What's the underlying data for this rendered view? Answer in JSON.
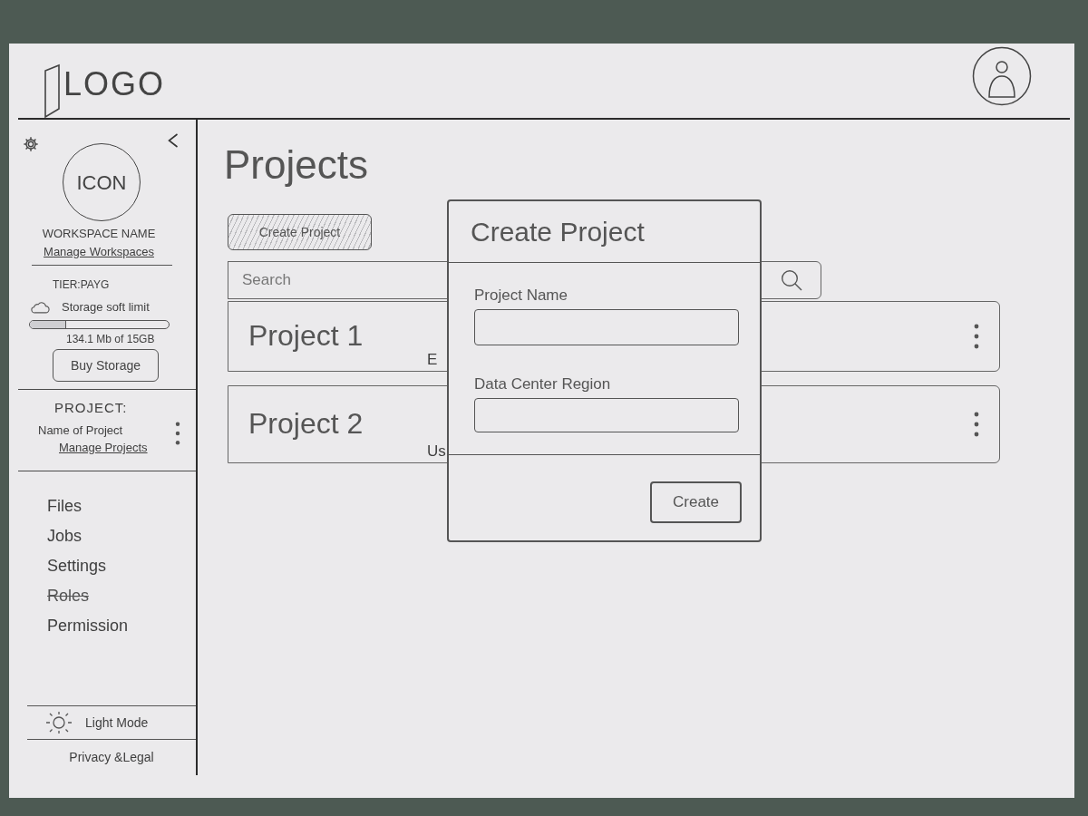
{
  "header": {
    "logo_text": "LOGO"
  },
  "sidebar": {
    "workspace": {
      "icon_text": "ICON",
      "name": "WORKSPACE NAME",
      "manage_link": "Manage Workspaces"
    },
    "tier": "TIER:PAYG",
    "storage": {
      "label": "Storage soft limit",
      "level": 0.26,
      "reading": "134.1 Mb of 15GB",
      "button": "Buy Storage"
    },
    "project": {
      "heading": "PROJECT:",
      "name": "Name of Project",
      "manage_link": "Manage Projects"
    },
    "nav_items": [
      {
        "label": "Files",
        "struck": false
      },
      {
        "label": "Jobs",
        "struck": false
      },
      {
        "label": "Settings",
        "struck": false
      },
      {
        "label": "Roles",
        "struck": true
      },
      {
        "label": "Permission",
        "struck": false
      }
    ],
    "theme_toggle": "Light Mode",
    "footer_link": "Privacy &Legal"
  },
  "main": {
    "title": "Projects",
    "create_button": "Create Project",
    "search": {
      "placeholder": "Search"
    },
    "projects": [
      {
        "name": "Project 1",
        "detail": "E"
      },
      {
        "name": "Project 2",
        "detail": "Us"
      }
    ]
  },
  "dialog": {
    "title": "Create Project",
    "fields": [
      {
        "label": "Project Name"
      },
      {
        "label": "Data Center Region"
      }
    ],
    "submit": "Create"
  }
}
